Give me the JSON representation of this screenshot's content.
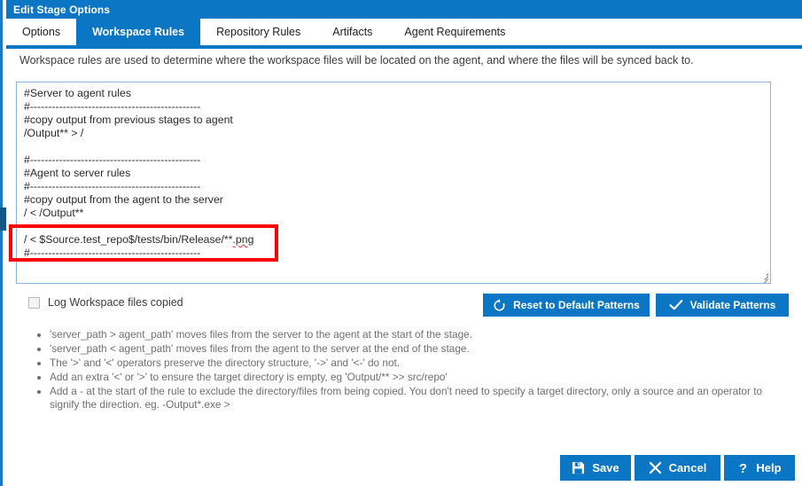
{
  "window": {
    "title": "Edit Stage Options"
  },
  "colors": {
    "accent_blue": "#0b77c4",
    "annotation_red": "#ff0000",
    "editor_border": "#8bb4e0",
    "hint_text": "#6f6f6f"
  },
  "tabs": [
    {
      "label": "Options",
      "active": false
    },
    {
      "label": "Workspace Rules",
      "active": true
    },
    {
      "label": "Repository Rules",
      "active": false
    },
    {
      "label": "Artifacts",
      "active": false
    },
    {
      "label": "Agent Requirements",
      "active": false
    }
  ],
  "description": "Workspace rules are used to determine where the workspace files will be located on the agent, and where the files will be synced back to.",
  "editor": {
    "name": "workspace-rules-editor",
    "lines": [
      "#Server to agent rules",
      "#-----------------------------------------------",
      "#copy output from previous stages to agent",
      "/Output** > /",
      "",
      "#-----------------------------------------------",
      "#Agent to server rules",
      "#-----------------------------------------------",
      "#copy output from the agent to the server",
      "/ < /Output**",
      "",
      "/ < $Source.test_repo$/tests/bin/Release/**.png",
      "#-----------------------------------------------"
    ],
    "highlighted_line_index": 11,
    "highlighted_line_text": "/ < $Source.test_repo$/tests/bin/Release/**.png",
    "misspelled_token": ".png"
  },
  "checkbox": {
    "label": "Log Workspace files copied",
    "checked": false
  },
  "pattern_buttons": {
    "reset_label": "Reset to Default Patterns",
    "reset_icon": "refresh-icon",
    "validate_label": "Validate Patterns",
    "validate_icon": "check-icon"
  },
  "hints": [
    "'server_path > agent_path' moves files from the server to the agent at the start of the stage.",
    "'server_path < agent_path' moves files from the agent to the server at the end of the stage.",
    "The '>' and '<' operators preserve the directory structure, '->' and '<-' do not.",
    "Add an extra '<' or '>' to ensure the target directory is empty, eg 'Output/** >> src/repo'",
    "Add a - at the start of the rule to exclude the directory/files from being copied. You don't need to specify a target directory, only a source and an operator to signify the direction. eg. -Output*.exe >"
  ],
  "footer_buttons": {
    "save_label": "Save",
    "save_icon": "save-disk-icon",
    "cancel_label": "Cancel",
    "cancel_icon": "close-x-icon",
    "help_label": "Help",
    "help_icon": "question-mark-icon"
  }
}
